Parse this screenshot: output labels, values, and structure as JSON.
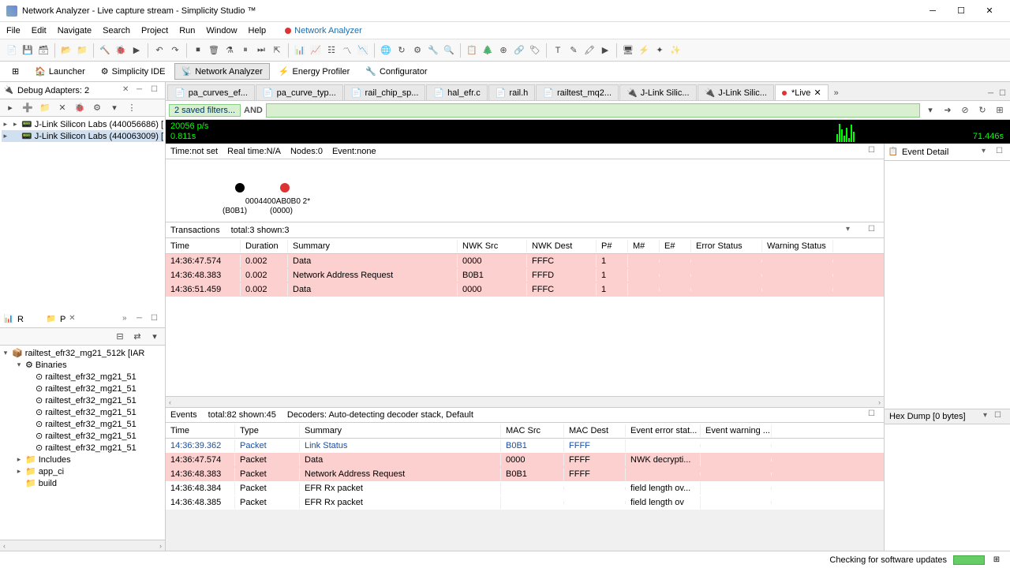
{
  "window": {
    "title": "Network Analyzer - Live capture stream - Simplicity Studio ™"
  },
  "menu": {
    "items": [
      "File",
      "Edit",
      "Navigate",
      "Search",
      "Project",
      "Run",
      "Window",
      "Help"
    ],
    "link": "Network Analyzer"
  },
  "perspectives": {
    "launcher": "Launcher",
    "ide": "Simplicity IDE",
    "na": "Network Analyzer",
    "ep": "Energy Profiler",
    "cfg": "Configurator"
  },
  "debugAdapters": {
    "title": "Debug Adapters: 2",
    "items": [
      {
        "label": "J-Link Silicon Labs (440056686) ["
      },
      {
        "label": "J-Link Silicon Labs (440063009) ["
      }
    ]
  },
  "project": {
    "tabs": {
      "r": "R",
      "p": "P"
    },
    "root": "railtest_efr32_mg21_512k [IAR",
    "binaries": "Binaries",
    "bins": [
      "railtest_efr32_mg21_51",
      "railtest_efr32_mg21_51",
      "railtest_efr32_mg21_51",
      "railtest_efr32_mg21_51",
      "railtest_efr32_mg21_51",
      "railtest_efr32_mg21_51",
      "railtest_efr32_mg21_51"
    ],
    "includes": "Includes",
    "appc": "app_ci",
    "build": "build"
  },
  "editorTabs": [
    "pa_curves_ef...",
    "pa_curve_typ...",
    "rail_chip_sp...",
    "hal_efr.c",
    "rail.h",
    "railtest_mq2...",
    "J-Link Silic...",
    "J-Link Silic..."
  ],
  "liveTab": "*Live",
  "filter": {
    "saved": "2 saved filters...",
    "and": "AND"
  },
  "stream": {
    "l1": "20056 p/s",
    "l2": "0.811s",
    "rt": "71.446s"
  },
  "info": {
    "time": "Time:not set",
    "realtime": "Real time:N/A",
    "nodes": "Nodes:0",
    "event": "Event:none"
  },
  "nodes": {
    "a_id": "0004400AB0B0 2*",
    "a_addr": "(B0B1)",
    "b_addr": "(0000)"
  },
  "transactions": {
    "title": "Transactions",
    "counts": "total:3 shown:3",
    "cols": {
      "time": "Time",
      "dur": "Duration",
      "sum": "Summary",
      "nwks": "NWK Src",
      "nwkd": "NWK Dest",
      "p": "P#",
      "m": "M#",
      "e": "E#",
      "err": "Error Status",
      "warn": "Warning Status"
    },
    "rows": [
      {
        "time": "14:36:47.574",
        "dur": "0.002",
        "sum": "Data",
        "nwks": "0000",
        "nwkd": "FFFC",
        "p": "1"
      },
      {
        "time": "14:36:48.383",
        "dur": "0.002",
        "sum": "Network Address Request",
        "nwks": "B0B1",
        "nwkd": "FFFD",
        "p": "1"
      },
      {
        "time": "14:36:51.459",
        "dur": "0.002",
        "sum": "Data",
        "nwks": "0000",
        "nwkd": "FFFC",
        "p": "1"
      }
    ]
  },
  "events": {
    "title": "Events",
    "counts": "total:82 shown:45",
    "decoders": "Decoders: Auto-detecting decoder stack, Default",
    "cols": {
      "time": "Time",
      "type": "Type",
      "sum": "Summary",
      "macs": "MAC Src",
      "macd": "MAC Dest",
      "err": "Event error stat...",
      "warn": "Event warning ..."
    },
    "rows": [
      {
        "time": "14:36:39.362",
        "type": "Packet",
        "sum": "Link Status",
        "macs": "B0B1",
        "macd": "FFFF",
        "err": "",
        "cls": "blue"
      },
      {
        "time": "14:36:47.574",
        "type": "Packet",
        "sum": "Data",
        "macs": "0000",
        "macd": "FFFF",
        "err": "NWK decrypti...",
        "cls": "pink"
      },
      {
        "time": "14:36:48.383",
        "type": "Packet",
        "sum": "Network Address Request",
        "macs": "B0B1",
        "macd": "FFFF",
        "err": "",
        "cls": "pink"
      },
      {
        "time": "14:36:48.384",
        "type": "Packet",
        "sum": "EFR Rx packet",
        "macs": "",
        "macd": "",
        "err": "field length ov...",
        "cls": ""
      },
      {
        "time": "14:36:48.385",
        "type": "Packet",
        "sum": "EFR Rx packet",
        "macs": "",
        "macd": "",
        "err": "field length ov",
        "cls": ""
      }
    ]
  },
  "eventDetail": {
    "title": "Event Detail"
  },
  "hex": {
    "title": "Hex Dump [0 bytes]"
  },
  "status": {
    "msg": "Checking for software updates"
  }
}
